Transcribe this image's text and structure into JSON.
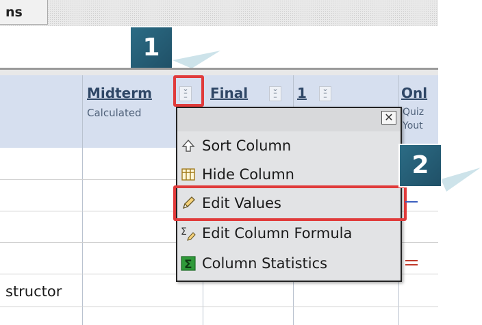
{
  "top_button": {
    "label": "ns"
  },
  "columns": [
    {
      "title": "Midterm",
      "subtitle": "Calculated"
    },
    {
      "title": "Final",
      "subtitle": ""
    },
    {
      "title": "1",
      "subtitle": ""
    },
    {
      "title": "Onl",
      "subtitle_lines": [
        "Quiz",
        "Yout"
      ]
    }
  ],
  "steps": [
    {
      "number": "1"
    },
    {
      "number": "2"
    }
  ],
  "menu": {
    "close_label": "✕",
    "items": [
      {
        "label": "Sort Column",
        "icon": "sort-up-arrow-icon"
      },
      {
        "label": "Hide Column",
        "icon": "hide-column-icon"
      },
      {
        "label": "Edit Values",
        "icon": "pencil-icon"
      },
      {
        "label": "Edit Column Formula",
        "icon": "formula-sigma-pencil-icon"
      },
      {
        "label": "Column Statistics",
        "icon": "statistics-sigma-icon"
      }
    ]
  },
  "rows": {
    "partial_label": "structor"
  },
  "colors": {
    "highlight": "#e03b3b",
    "badge": "#24607a",
    "header_bg": "#d6dfef"
  }
}
